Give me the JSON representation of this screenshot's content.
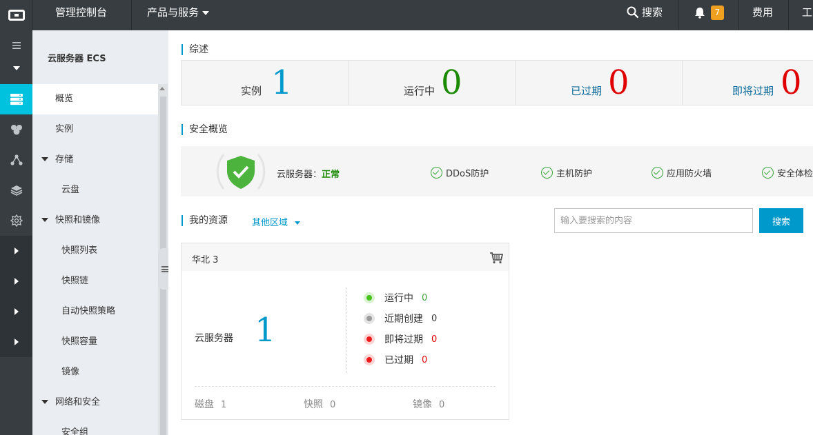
{
  "header": {
    "console_label": "管理控制台",
    "products_label": "产品与服务",
    "search_label": "搜索",
    "notification_count": "7",
    "billing_label": "费用",
    "truncated_label": "工"
  },
  "sidebar": {
    "title": "云服务器 ECS",
    "items": [
      {
        "label": "概览"
      },
      {
        "label": "实例"
      },
      {
        "label": "存储"
      },
      {
        "label": "云盘"
      },
      {
        "label": "快照和镜像"
      },
      {
        "label": "快照列表"
      },
      {
        "label": "快照链"
      },
      {
        "label": "自动快照策略"
      },
      {
        "label": "快照容量"
      },
      {
        "label": "镜像"
      },
      {
        "label": "网络和安全"
      },
      {
        "label": "安全组"
      }
    ]
  },
  "overview": {
    "title": "综述",
    "cells": [
      {
        "label": "实例",
        "value": "1",
        "color": "#0099cc"
      },
      {
        "label": "运行中",
        "value": "0",
        "color": "#1c8a00"
      },
      {
        "label": "已过期",
        "value": "0",
        "color": "#e00000"
      },
      {
        "label": "即将过期",
        "value": "0",
        "color": "#e00000"
      }
    ]
  },
  "security": {
    "title": "安全概览",
    "status_prefix": "云服务器：",
    "status_value": "正常",
    "checks": [
      "DDoS防护",
      "主机防护",
      "应用防火墙",
      "安全体检"
    ]
  },
  "resources": {
    "title": "我的资源",
    "region_select": "其他区域",
    "search_placeholder": "输入要搜索的内容",
    "search_button": "搜索",
    "card": {
      "region": "华北 3",
      "ecs_label": "云服务器",
      "ecs_count": "1",
      "stats": [
        {
          "label": "运行中",
          "value": "0",
          "status": "green"
        },
        {
          "label": "近期创建",
          "value": "0",
          "status": "grey"
        },
        {
          "label": "即将过期",
          "value": "0",
          "status": "red"
        },
        {
          "label": "已过期",
          "value": "0",
          "status": "red"
        }
      ],
      "footer": [
        {
          "label": "磁盘",
          "value": "1"
        },
        {
          "label": "快照",
          "value": "0"
        },
        {
          "label": "镜像",
          "value": "0"
        }
      ]
    }
  }
}
